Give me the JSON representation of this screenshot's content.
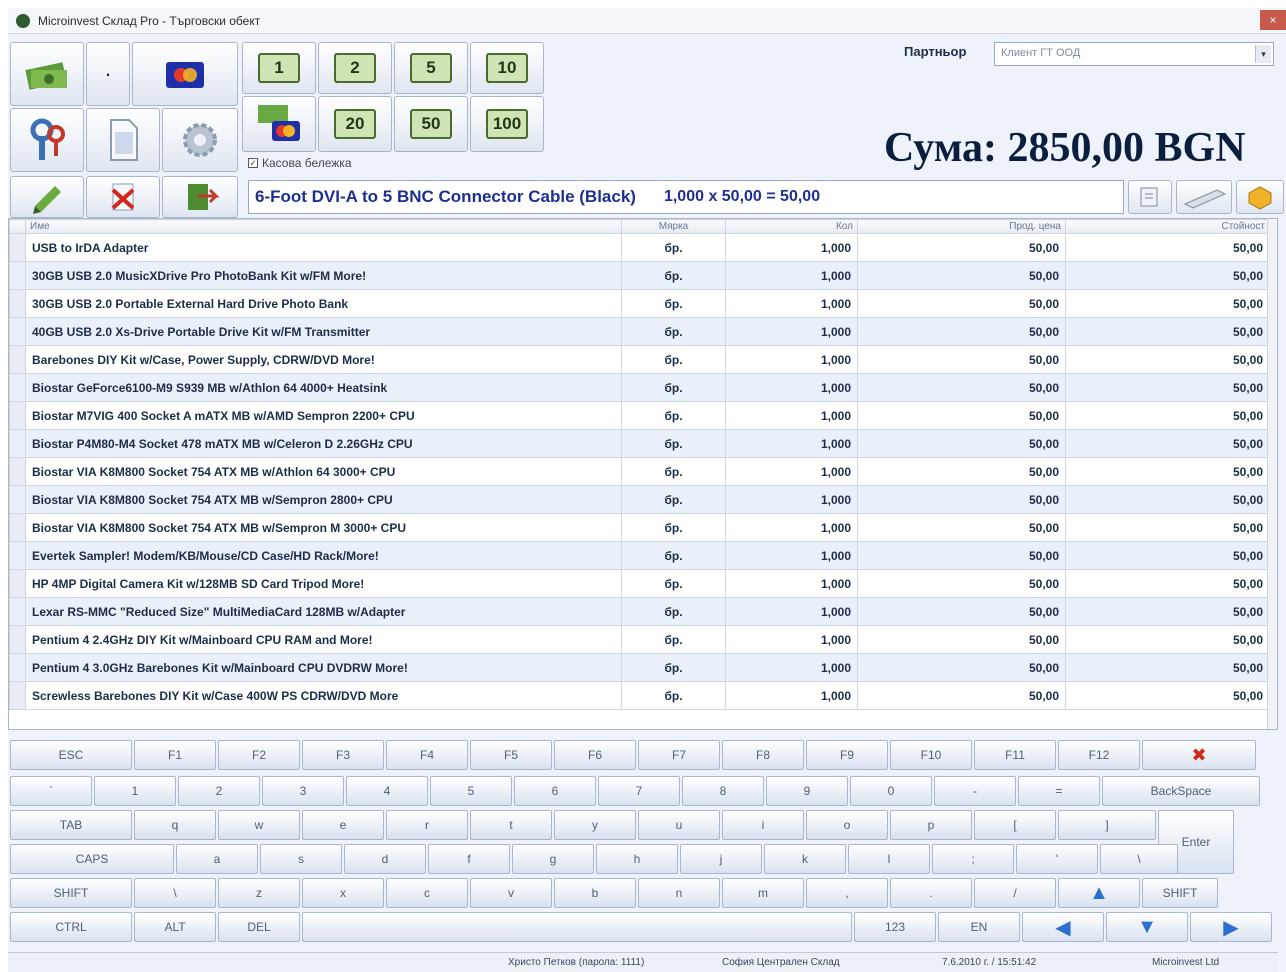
{
  "window": {
    "title": "Microinvest Склад Pro - Търговски обект",
    "close_glyph": "×"
  },
  "toolbar": {
    "dot_label": "·",
    "money_buttons": [
      "1",
      "2",
      "5",
      "10",
      "20",
      "50",
      "100"
    ],
    "checkbox_label": "Касова бележка",
    "checkbox_mark": "✓"
  },
  "partner": {
    "label": "Партньор",
    "value": "Клиент ГТ ООД",
    "arrow": "▾"
  },
  "total": {
    "text": "Сума:  2850,00 BGN"
  },
  "current_item": {
    "name": "6-Foot DVI-A to 5 BNC Connector Cable (Black)",
    "calc": "1,000  x  50,00  =  50,00"
  },
  "table": {
    "headers": [
      "Име",
      "Мярка",
      "Кол",
      "Прод. цена",
      "Стойност"
    ],
    "rows": [
      [
        "USB to IrDA Adapter",
        "бр.",
        "1,000",
        "50,00",
        "50,00"
      ],
      [
        "30GB USB 2.0 MusicXDrive Pro PhotoBank Kit w/FM  More!",
        "бр.",
        "1,000",
        "50,00",
        "50,00"
      ],
      [
        "30GB USB 2.0 Portable External Hard Drive  Photo Bank",
        "бр.",
        "1,000",
        "50,00",
        "50,00"
      ],
      [
        "40GB USB 2.0 Xs-Drive Portable Drive Kit w/FM Transmitter",
        "бр.",
        "1,000",
        "50,00",
        "50,00"
      ],
      [
        "Barebones DIY Kit w/Case, Power Supply, CDRW/DVD  More!",
        "бр.",
        "1,000",
        "50,00",
        "50,00"
      ],
      [
        "Biostar GeForce6100-M9 S939 MB w/Athlon 64 4000+  Heatsink",
        "бр.",
        "1,000",
        "50,00",
        "50,00"
      ],
      [
        "Biostar M7VIG 400 Socket A mATX MB w/AMD Sempron 2200+ CPU",
        "бр.",
        "1,000",
        "50,00",
        "50,00"
      ],
      [
        "Biostar P4M80-M4 Socket 478 mATX MB w/Celeron D 2.26GHz CPU",
        "бр.",
        "1,000",
        "50,00",
        "50,00"
      ],
      [
        "Biostar VIA K8M800 Socket 754 ATX MB w/Athlon 64 3000+ CPU",
        "бр.",
        "1,000",
        "50,00",
        "50,00"
      ],
      [
        "Biostar VIA K8M800 Socket 754 ATX MB w/Sempron 2800+ CPU",
        "бр.",
        "1,000",
        "50,00",
        "50,00"
      ],
      [
        "Biostar VIA K8M800 Socket 754 ATX MB w/Sempron M 3000+ CPU",
        "бр.",
        "1,000",
        "50,00",
        "50,00"
      ],
      [
        "Evertek Sampler! Modem/KB/Mouse/CD Case/HD Rack/More!",
        "бр.",
        "1,000",
        "50,00",
        "50,00"
      ],
      [
        "HP 4MP Digital Camera Kit w/128MB SD Card Tripod  More!",
        "бр.",
        "1,000",
        "50,00",
        "50,00"
      ],
      [
        "Lexar RS-MMC \"Reduced Size\" MultiMediaCard 128MB w/Adapter",
        "бр.",
        "1,000",
        "50,00",
        "50,00"
      ],
      [
        "Pentium 4 2.4GHz DIY Kit w/Mainboard CPU RAM and More!",
        "бр.",
        "1,000",
        "50,00",
        "50,00"
      ],
      [
        "Pentium 4 3.0GHz Barebones Kit w/Mainboard CPU DVDRW More!",
        "бр.",
        "1,000",
        "50,00",
        "50,00"
      ],
      [
        "Screwless Barebones DIY Kit w/Case 400W PS CDRW/DVD  More",
        "бр.",
        "1,000",
        "50,00",
        "50,00"
      ]
    ]
  },
  "keyboard": {
    "row1": [
      "ESC",
      "F1",
      "F2",
      "F3",
      "F4",
      "F5",
      "F6",
      "F7",
      "F8",
      "F9",
      "F10",
      "F11",
      "F12",
      "✖"
    ],
    "row2": [
      "`",
      "1",
      "2",
      "3",
      "4",
      "5",
      "6",
      "7",
      "8",
      "9",
      "0",
      "-",
      "=",
      "BackSpace"
    ],
    "row3": [
      "TAB",
      "q",
      "w",
      "e",
      "r",
      "t",
      "y",
      "u",
      "i",
      "o",
      "p",
      "[",
      "]",
      "Enter"
    ],
    "row4": [
      "CAPS",
      "a",
      "s",
      "d",
      "f",
      "g",
      "h",
      "j",
      "k",
      "l",
      ";",
      "'",
      "\\"
    ],
    "row5": [
      "SHIFT",
      "\\",
      "z",
      "x",
      "c",
      "v",
      "b",
      "n",
      "m",
      ",",
      ".",
      "/",
      "▲",
      "SHIFT"
    ],
    "row6": [
      "CTRL",
      "ALT",
      "DEL",
      "",
      "123",
      "EN",
      "◀",
      "▼",
      "▶"
    ]
  },
  "status": {
    "user": "Христо Петков (парола: 1111)",
    "location": "София Централен Склад",
    "datetime": "7.6.2010 г. / 15:51:42",
    "company": "Microinvest Ltd"
  }
}
